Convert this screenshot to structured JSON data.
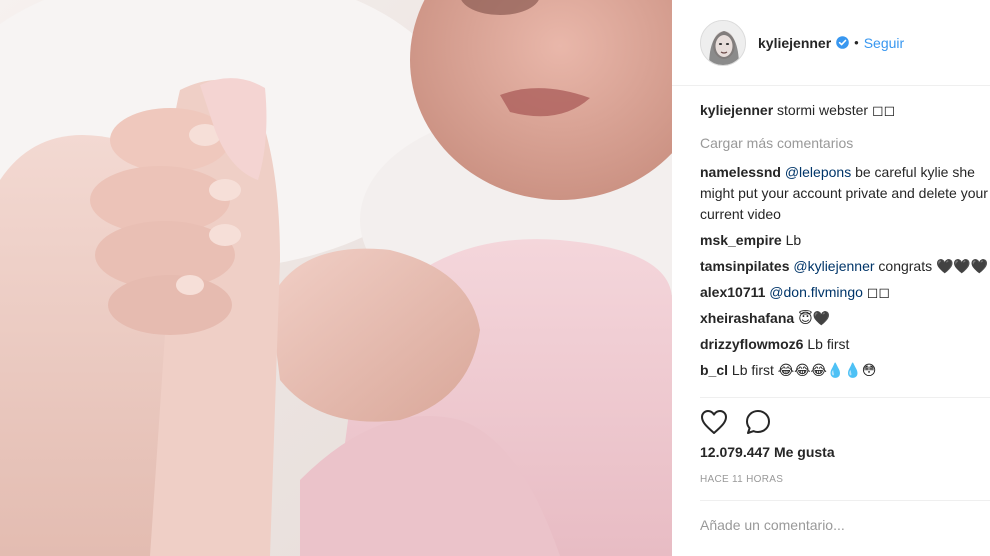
{
  "post": {
    "username": "kyliejenner",
    "separator": "•",
    "follow_label": "Seguir",
    "caption": {
      "user": "kyliejenner",
      "text": "stormi webster ◻◻"
    },
    "load_more_label": "Cargar más comentarios",
    "comments": [
      {
        "user": "namelessnd",
        "mention": "@lelepons",
        "text": " be careful kylie she might put your account private and delete your current video"
      },
      {
        "user": "msk_empire",
        "mention": "",
        "text": "Lb"
      },
      {
        "user": "tamsinpilates",
        "mention": "@kyliejenner",
        "text": " congrats 🖤🖤🖤"
      },
      {
        "user": "alex10711",
        "mention": "@don.flvmingo",
        "text": " ◻◻"
      },
      {
        "user": "xheirashafana",
        "mention": "",
        "text": "😇🖤"
      },
      {
        "user": "drizzyflowmoz6",
        "mention": "",
        "text": "Lb first"
      },
      {
        "user": "b_cl",
        "mention": "",
        "text": "Lb first 😂😂😂💧💧😳"
      }
    ],
    "likes_label": "12.079.447 Me gusta",
    "timestamp": "HACE 11 HORAS",
    "add_comment_placeholder": "Añade un comentario..."
  },
  "icons": {
    "like": "heart-outline-icon",
    "comment": "speech-bubble-icon",
    "verified": "verified-badge-icon"
  },
  "colors": {
    "link": "#3897f0",
    "mention": "#003569",
    "muted": "#999999",
    "text": "#262626",
    "verified": "#3897f0"
  }
}
